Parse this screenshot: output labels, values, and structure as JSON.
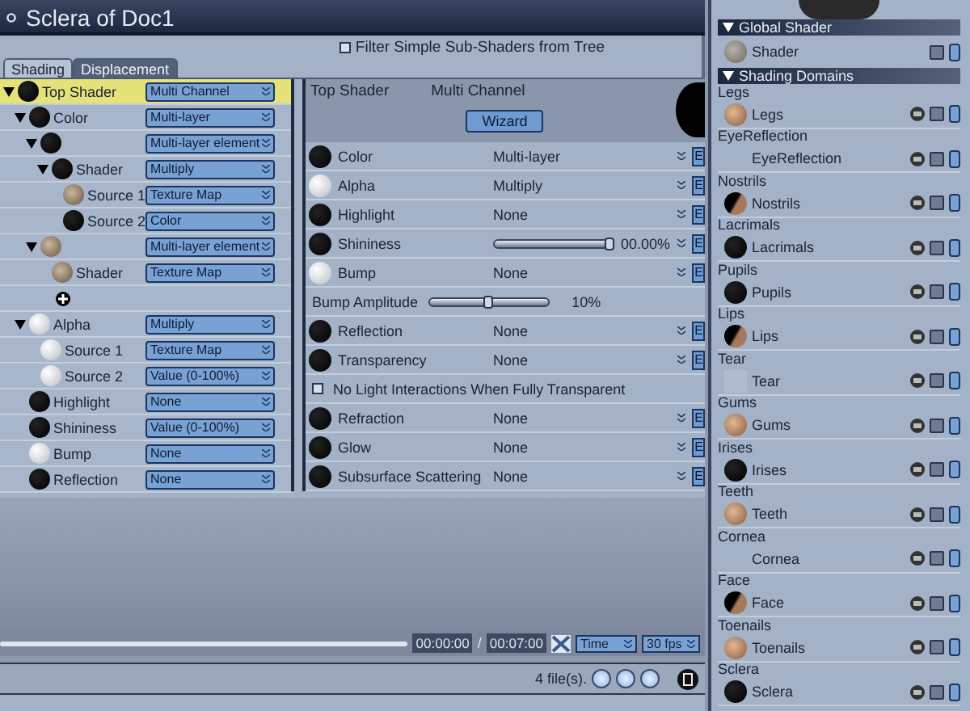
{
  "window": {
    "title": "Sclera of Doc1"
  },
  "filter": {
    "label": "Filter Simple Sub-Shaders from Tree",
    "checked": false
  },
  "tabs": [
    {
      "label": "Shading",
      "selected": true
    },
    {
      "label": "Displacement",
      "selected": false
    }
  ],
  "tree": [
    {
      "label": "Top Shader",
      "swatch": {
        "kind": "black"
      },
      "value": "Multi Channel",
      "selected": true,
      "expanded": true,
      "children": [
        {
          "label": "Color",
          "swatch": {
            "kind": "black"
          },
          "value": "Multi-layer",
          "selected": false,
          "expanded": true,
          "children": [
            {
              "kind": "node",
              "swatch": {
                "kind": "black"
              },
              "value": "Multi-layer element",
              "selected": false,
              "expanded": true,
              "children": [
                {
                  "label": "Shader",
                  "swatch": {
                    "kind": "black"
                  },
                  "value": "Multiply",
                  "selected": false,
                  "expanded": true,
                  "children": [
                    {
                      "label": "Source 1",
                      "swatch": {
                        "kind": "texture"
                      },
                      "value": "Texture Map",
                      "selected": false
                    },
                    {
                      "label": "Source 2",
                      "swatch": {
                        "kind": "black"
                      },
                      "value": "Color",
                      "selected": false
                    }
                  ]
                }
              ]
            },
            {
              "kind": "node",
              "swatch": {
                "kind": "texture"
              },
              "value": "Multi-layer element",
              "selected": false,
              "expanded": true,
              "children": [
                {
                  "label": "Shader",
                  "swatch": {
                    "kind": "texture"
                  },
                  "value": "Texture Map",
                  "selected": false
                }
              ]
            },
            {
              "kind": "add"
            }
          ]
        },
        {
          "label": "Alpha",
          "swatch": {
            "kind": "white"
          },
          "value": "Multiply",
          "selected": false,
          "expanded": true,
          "children": [
            {
              "label": "Source 1",
              "swatch": {
                "kind": "white"
              },
              "value": "Texture Map",
              "selected": false
            },
            {
              "label": "Source 2",
              "swatch": {
                "kind": "white"
              },
              "value": "Value (0-100%)",
              "selected": false
            }
          ]
        },
        {
          "label": "Highlight",
          "swatch": {
            "kind": "black"
          },
          "value": "None",
          "selected": false
        },
        {
          "label": "Shininess",
          "swatch": {
            "kind": "black"
          },
          "value": "Value (0-100%)",
          "selected": false
        },
        {
          "label": "Bump",
          "swatch": {
            "kind": "white"
          },
          "value": "None",
          "selected": false
        },
        {
          "label": "Reflection",
          "swatch": {
            "kind": "black"
          },
          "value": "None",
          "selected": false
        }
      ]
    }
  ],
  "properties": {
    "title": "Top Shader",
    "type": "Multi Channel",
    "wizard": "Wizard",
    "rows": [
      {
        "kind": "value",
        "label": "Color",
        "swatch": {
          "kind": "black"
        },
        "value": "Multi-layer",
        "button": "E"
      },
      {
        "kind": "value",
        "label": "Alpha",
        "swatch": {
          "kind": "white"
        },
        "value": "Multiply",
        "button": "E"
      },
      {
        "kind": "value",
        "label": "Highlight",
        "swatch": {
          "kind": "black"
        },
        "value": "None",
        "button": "E"
      },
      {
        "kind": "slider",
        "label": "Shininess",
        "swatch": {
          "kind": "black"
        },
        "level": 0.97,
        "reading": "00.00%",
        "button": "E"
      },
      {
        "kind": "value",
        "label": "Bump",
        "swatch": {
          "kind": "white"
        },
        "value": "None",
        "button": "E",
        "sub_slider": {
          "label": "Bump Amplitude",
          "level": 0.5,
          "reading": "10%"
        }
      },
      {
        "kind": "value",
        "label": "Reflection",
        "swatch": {
          "kind": "black"
        },
        "value": "None",
        "button": "E"
      },
      {
        "kind": "value",
        "label": "Transparency",
        "swatch": {
          "kind": "black"
        },
        "value": "None",
        "button": "E",
        "option": {
          "label": "No Light Interactions When Fully Transparent",
          "checked": false
        }
      },
      {
        "kind": "value",
        "label": "Refraction",
        "swatch": {
          "kind": "black"
        },
        "value": "None",
        "button": "E"
      },
      {
        "kind": "value",
        "label": "Glow",
        "swatch": {
          "kind": "black"
        },
        "value": "None",
        "button": "E"
      },
      {
        "kind": "value",
        "label": "Subsurface Scattering",
        "swatch": {
          "kind": "black"
        },
        "value": "None",
        "button": "E"
      }
    ]
  },
  "timeline": {
    "current": "00:00:00",
    "separator": "/",
    "total": "00:07:00",
    "mode": "Time",
    "fps": "30 fps"
  },
  "status_bar": {
    "files": "4 file(s)."
  },
  "global_shader": {
    "title": "Global Shader",
    "expanded": true,
    "items": [
      {
        "name": "Shader",
        "swatch": {
          "kind": "gray"
        }
      }
    ]
  },
  "shading_domains": {
    "title": "Shading Domains",
    "expanded": true,
    "items": [
      {
        "group": "Legs",
        "name": "Legs",
        "swatch": {
          "kind": "skin"
        }
      },
      {
        "group": "EyeReflection",
        "name": "EyeReflection",
        "swatch": {
          "kind": "none"
        }
      },
      {
        "group": "Nostrils",
        "name": "Nostrils",
        "swatch": {
          "kind": "dark"
        }
      },
      {
        "group": "Lacrimals",
        "name": "Lacrimals",
        "swatch": {
          "kind": "black"
        }
      },
      {
        "group": "Pupils",
        "name": "Pupils",
        "swatch": {
          "kind": "black"
        }
      },
      {
        "group": "Lips",
        "name": "Lips",
        "swatch": {
          "kind": "dark"
        }
      },
      {
        "group": "Tear",
        "name": "Tear",
        "swatch": {
          "kind": "clear"
        }
      },
      {
        "group": "Gums",
        "name": "Gums",
        "swatch": {
          "kind": "skin"
        }
      },
      {
        "group": "Irises",
        "name": "Irises",
        "swatch": {
          "kind": "black"
        }
      },
      {
        "group": "Teeth",
        "name": "Teeth",
        "swatch": {
          "kind": "skin"
        }
      },
      {
        "group": "Cornea",
        "name": "Cornea",
        "swatch": {
          "kind": "none"
        }
      },
      {
        "group": "Face",
        "name": "Face",
        "swatch": {
          "kind": "dark"
        }
      },
      {
        "group": "Toenails",
        "name": "Toenails",
        "swatch": {
          "kind": "skin"
        }
      },
      {
        "group": "Sclera",
        "name": "Sclera",
        "swatch": {
          "kind": "black"
        }
      }
    ]
  }
}
